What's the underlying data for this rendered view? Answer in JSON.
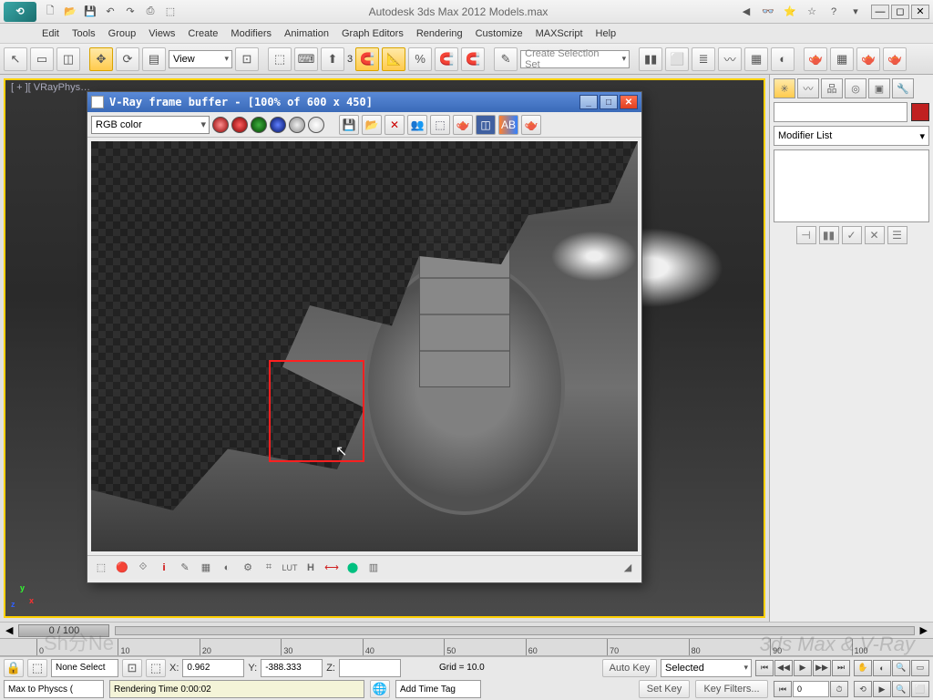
{
  "app": {
    "title": "Autodesk 3ds Max 2012    Models.max",
    "logo_text": "⟲"
  },
  "title_icons": [
    "🗋",
    "📂",
    "💾",
    "↶",
    "↷",
    "⎙",
    "⬚"
  ],
  "title_right_icons": [
    "⌕",
    "👓",
    "⭐",
    "☆",
    "?",
    "▾"
  ],
  "menu": [
    "Edit",
    "Tools",
    "Group",
    "Views",
    "Create",
    "Modifiers",
    "Animation",
    "Graph Editors",
    "Rendering",
    "Customize",
    "MAXScript",
    "Help"
  ],
  "toolbar": {
    "view_label": "View",
    "selection_set_placeholder": "Create Selection Set",
    "angle_snap_value": "3"
  },
  "viewport": {
    "label": "[ + ][ VRayPhys…"
  },
  "cmd": {
    "modifier_list_label": "Modifier List"
  },
  "vfb": {
    "title": "V-Ray frame buffer - [100% of 600 x 450]",
    "channel_label": "RGB color",
    "channels": [
      {
        "color": "radial-gradient(#ff6060,#800000)",
        "name": "red"
      },
      {
        "color": "radial-gradient(#40b040,#004000)",
        "name": "green"
      },
      {
        "color": "radial-gradient(#6080ff,#001060)",
        "name": "blue"
      },
      {
        "color": "radial-gradient(#f0f0f0,#888)",
        "name": "alpha"
      },
      {
        "color": "radial-gradient(#fff,#ccc)",
        "name": "mono"
      }
    ],
    "bottom_labels": [
      "⬚",
      "🔴",
      "⟐",
      "i",
      "✎",
      "▦",
      "◐",
      "⚙",
      "⌗",
      "LUT",
      "H",
      "⟷",
      "⬤",
      "▥"
    ]
  },
  "timeline": {
    "slider_text": "0 / 100",
    "ticks": [
      "0",
      "10",
      "20",
      "30",
      "40",
      "50",
      "60",
      "70",
      "80",
      "90",
      "100"
    ]
  },
  "status": {
    "selection": "None Select",
    "x_label": "X:",
    "x_val": "0.962",
    "y_label": "Y:",
    "y_val": "-388.333",
    "z_label": "Z:",
    "z_val": "",
    "grid_label": "Grid = 10.0",
    "autokey_label": "Auto Key",
    "selected_label": "Selected",
    "script_label": "Max to Physcs (",
    "render_time": "Rendering Time  0:00:02",
    "add_tag": "Add Time Tag",
    "setkey_label": "Set Key",
    "keyfilters_label": "Key Filters..."
  },
  "watermark": "3ds Max & V-Ray",
  "watermark2": "Sh分Ne"
}
